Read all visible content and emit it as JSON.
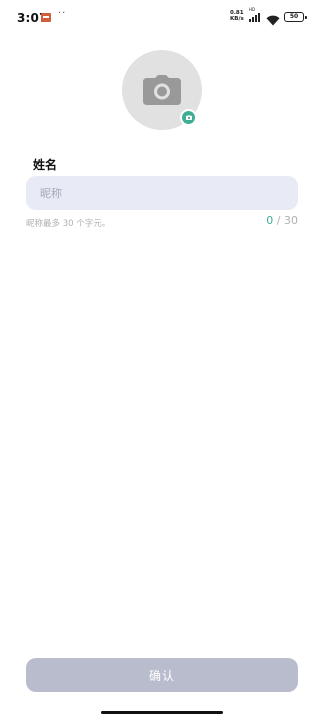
{
  "status_bar": {
    "time": "3:07",
    "dots": "··",
    "net_speed": "0.81\nKB/s",
    "hd_label": "HD",
    "battery": "50"
  },
  "icons": {
    "status_app": "notification-app-icon",
    "signal": "signal-icon",
    "wifi": "wifi-icon",
    "battery": "battery-icon",
    "avatar": "camera-icon",
    "badge": "camera-icon"
  },
  "profile": {
    "name_label": "姓名",
    "name_value": "",
    "name_placeholder": "昵称",
    "hint": "昵称最多 30 个字元。",
    "counter_current": "0",
    "counter_separator": " / ",
    "counter_max": "30"
  },
  "actions": {
    "confirm_label": "确认"
  },
  "colors": {
    "accent": "#3fae93",
    "input_background": "#e8eaf5",
    "button_disabled": "#b8bccd",
    "avatar_background": "#e1e1e1"
  }
}
